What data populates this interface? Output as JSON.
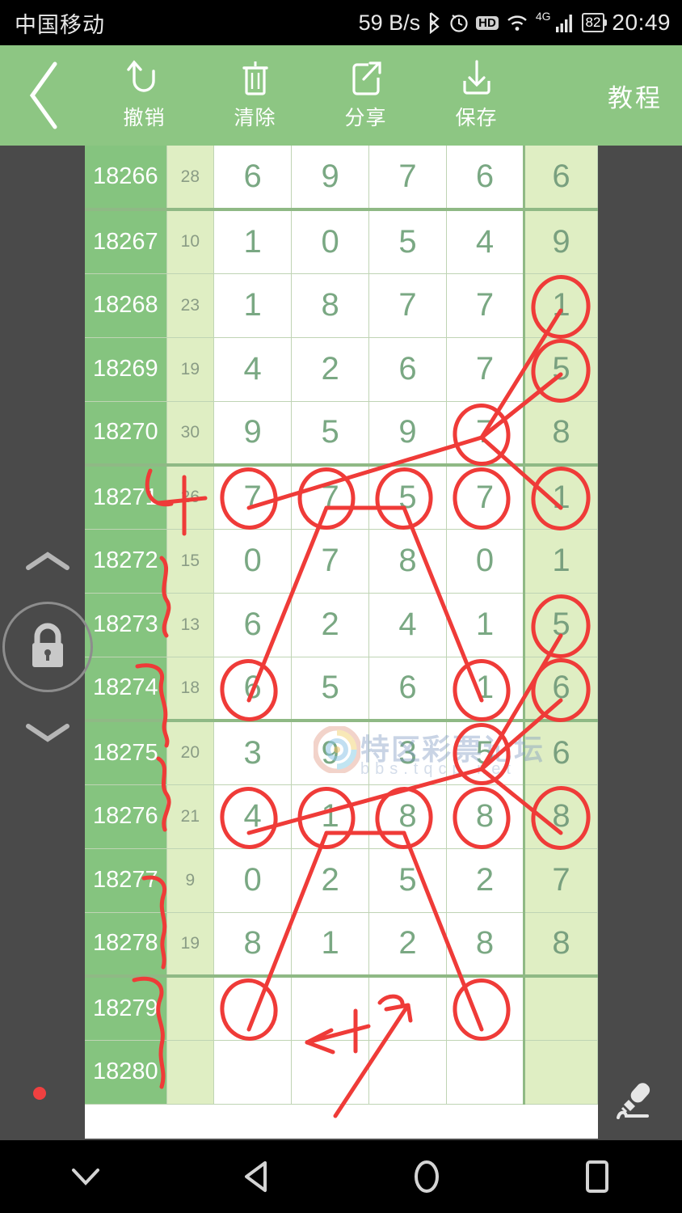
{
  "statusbar": {
    "carrier": "中国移动",
    "netspeed": "59 B/s",
    "bluetooth_icon": "bluetooth-icon",
    "alarm_icon": "alarm-icon",
    "hd_label": "HD",
    "wifi_icon": "wifi-icon",
    "network_label": "4G",
    "signal_icon": "signal-bars-icon",
    "battery_level": "82",
    "clock": "20:49"
  },
  "toolbar": {
    "back_icon": "back-chevron-icon",
    "items": [
      {
        "label": "撤销",
        "icon": "undo-arrow-icon"
      },
      {
        "label": "清除",
        "icon": "trash-icon"
      },
      {
        "label": "分享",
        "icon": "share-icon"
      },
      {
        "label": "保存",
        "icon": "download-save-icon"
      }
    ],
    "tutorial_label": "教程",
    "accent_color": "#8dc683"
  },
  "watermark": {
    "title": "特区彩票论坛",
    "url": "bbs.tqcp.net"
  },
  "left_controls": {
    "scroll_up_icon": "chevron-up-icon",
    "lock_icon": "lock-icon",
    "scroll_down_icon": "chevron-down-icon",
    "pen_icon": "pen-icon",
    "pen_color": "#f04040"
  },
  "navbar": {
    "hide_icon": "chevron-down-icon",
    "back_icon": "triangle-back-icon",
    "home_icon": "circle-home-icon",
    "recents_icon": "square-recents-icon"
  },
  "table": {
    "colors": {
      "id_cell": "#85c47f",
      "sum_cell": "#dfeec3",
      "digit_cell": "#ffffff",
      "special_cell": "#dfeec3",
      "digit_text": "#7aa883",
      "ink": "#ef3b38"
    },
    "rows": [
      {
        "id": "18266",
        "sum": "28",
        "digits": [
          "6",
          "9",
          "7",
          "6"
        ],
        "special": "6",
        "circled": [],
        "special_circled": false,
        "thick_bottom": true
      },
      {
        "id": "18267",
        "sum": "10",
        "digits": [
          "1",
          "0",
          "5",
          "4"
        ],
        "special": "9",
        "circled": [],
        "special_circled": false,
        "thick_bottom": false
      },
      {
        "id": "18268",
        "sum": "23",
        "digits": [
          "1",
          "8",
          "7",
          "7"
        ],
        "special": "1",
        "circled": [],
        "special_circled": true,
        "thick_bottom": false
      },
      {
        "id": "18269",
        "sum": "19",
        "digits": [
          "4",
          "2",
          "6",
          "7"
        ],
        "special": "5",
        "circled": [],
        "special_circled": true,
        "thick_bottom": false
      },
      {
        "id": "18270",
        "sum": "30",
        "digits": [
          "9",
          "5",
          "9",
          "7"
        ],
        "special": "8",
        "circled": [
          3
        ],
        "special_circled": false,
        "thick_bottom": true
      },
      {
        "id": "18271",
        "sum": "26",
        "digits": [
          "7",
          "7",
          "5",
          "7"
        ],
        "special": "1",
        "circled": [
          0,
          1,
          2,
          3
        ],
        "special_circled": true,
        "thick_bottom": false
      },
      {
        "id": "18272",
        "sum": "15",
        "digits": [
          "0",
          "7",
          "8",
          "0"
        ],
        "special": "1",
        "circled": [],
        "special_circled": false,
        "thick_bottom": false
      },
      {
        "id": "18273",
        "sum": "13",
        "digits": [
          "6",
          "2",
          "4",
          "1"
        ],
        "special": "5",
        "circled": [],
        "special_circled": true,
        "thick_bottom": false
      },
      {
        "id": "18274",
        "sum": "18",
        "digits": [
          "6",
          "5",
          "6",
          "1"
        ],
        "special": "6",
        "circled": [
          0,
          3
        ],
        "special_circled": true,
        "thick_bottom": true
      },
      {
        "id": "18275",
        "sum": "20",
        "digits": [
          "3",
          "9",
          "3",
          "5"
        ],
        "special": "6",
        "circled": [
          3
        ],
        "special_circled": false,
        "thick_bottom": false
      },
      {
        "id": "18276",
        "sum": "21",
        "digits": [
          "4",
          "1",
          "8",
          "8"
        ],
        "special": "8",
        "circled": [
          0,
          1,
          2,
          3
        ],
        "special_circled": true,
        "thick_bottom": false
      },
      {
        "id": "18277",
        "sum": "9",
        "digits": [
          "0",
          "2",
          "5",
          "2"
        ],
        "special": "7",
        "circled": [],
        "special_circled": false,
        "thick_bottom": false
      },
      {
        "id": "18278",
        "sum": "19",
        "digits": [
          "8",
          "1",
          "2",
          "8"
        ],
        "special": "8",
        "circled": [],
        "special_circled": false,
        "thick_bottom": true
      },
      {
        "id": "18279",
        "sum": "",
        "digits": [
          "",
          "",
          "",
          ""
        ],
        "special": "",
        "circled": [
          0,
          3
        ],
        "special_circled": false,
        "thick_bottom": false
      },
      {
        "id": "18280",
        "sum": "",
        "digits": [
          "",
          "",
          "",
          ""
        ],
        "special": "",
        "circled": [],
        "special_circled": false,
        "thick_bottom": false
      }
    ]
  }
}
